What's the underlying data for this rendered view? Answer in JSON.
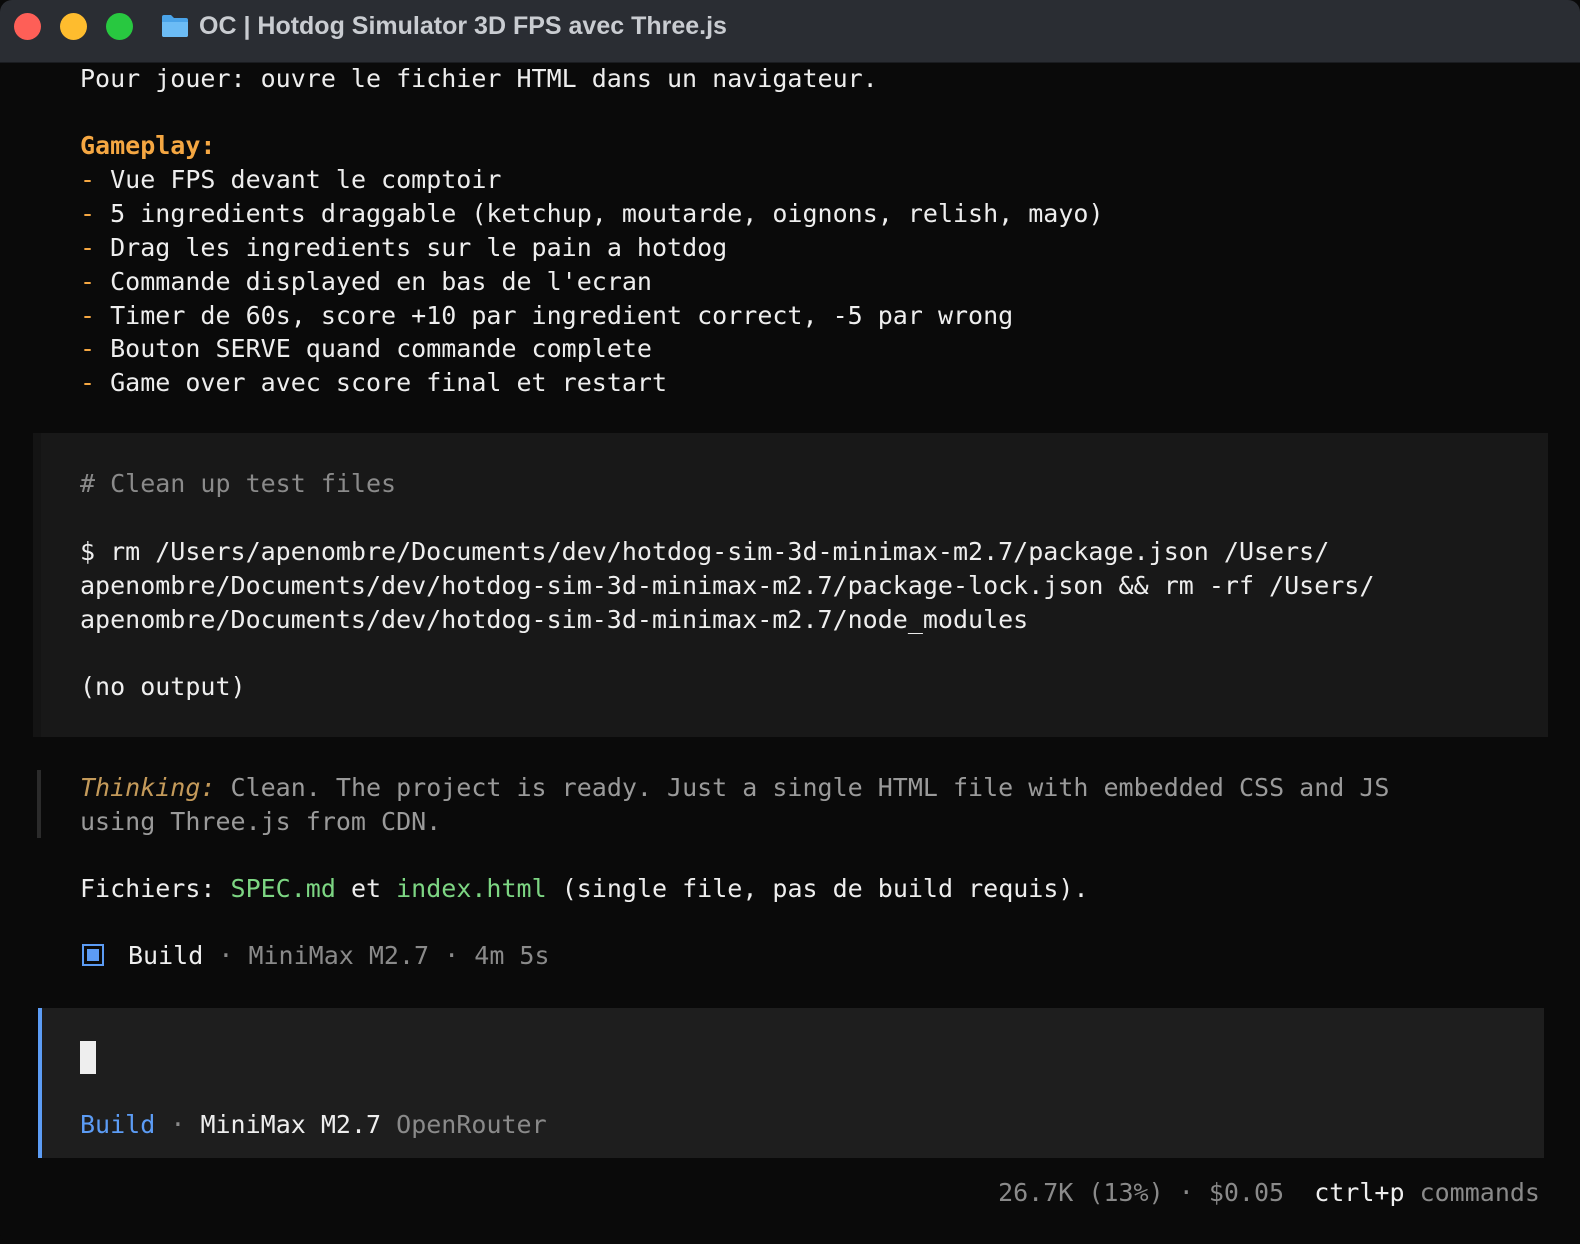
{
  "window": {
    "title": "OC | Hotdog Simulator 3D FPS avec Three.js"
  },
  "intro": "Pour jouer: ouvre le fichier HTML dans un navigateur.",
  "gameplay": {
    "heading": "Gameplay:",
    "bullet": "-",
    "items": [
      "Vue FPS devant le comptoir",
      "5 ingredients draggable (ketchup, moutarde, oignons, relish, mayo)",
      "Drag les ingredients sur le pain a hotdog",
      "Commande displayed en bas de l'ecran",
      "Timer de 60s, score +10 par ingredient correct, -5 par wrong",
      "Bouton SERVE quand commande complete",
      "Game over avec score final et restart"
    ]
  },
  "tool_block": {
    "comment": "# Clean up test files",
    "command_lines": [
      "$ rm /Users/apenombre/Documents/dev/hotdog-sim-3d-minimax-m2.7/package.json /Users/",
      "apenombre/Documents/dev/hotdog-sim-3d-minimax-m2.7/package-lock.json && rm -rf /Users/",
      "apenombre/Documents/dev/hotdog-sim-3d-minimax-m2.7/node_modules"
    ],
    "output": "(no output)"
  },
  "thinking": {
    "label": "Thinking:",
    "line1": "Clean. The project is ready. Just a single HTML file with embedded CSS and JS",
    "line2": "using Three.js from CDN."
  },
  "files": {
    "prefix": "Fichiers:",
    "file1": "SPEC.md",
    "joiner": "et",
    "file2": "index.html",
    "suffix": "(single file, pas de build requis)."
  },
  "build_summary": {
    "mode": "Build",
    "sep": "·",
    "model": "MiniMax M2.7",
    "duration": "4m 5s"
  },
  "prompt": {
    "mode": "Build",
    "sep": "·",
    "model": "MiniMax M2.7",
    "provider": "OpenRouter"
  },
  "status": {
    "tokens": "26.7K (13%)",
    "sep": "·",
    "cost": "$0.05",
    "shortcut": "ctrl+p",
    "shortcut_label": "commands"
  },
  "colors": {
    "accent_blue": "#5c9cf5",
    "heading_orange": "#f5a742",
    "file_green": "#7dd683",
    "background": "#0a0a0a"
  },
  "icons": [
    "folder-icon",
    "build-square-icon"
  ]
}
